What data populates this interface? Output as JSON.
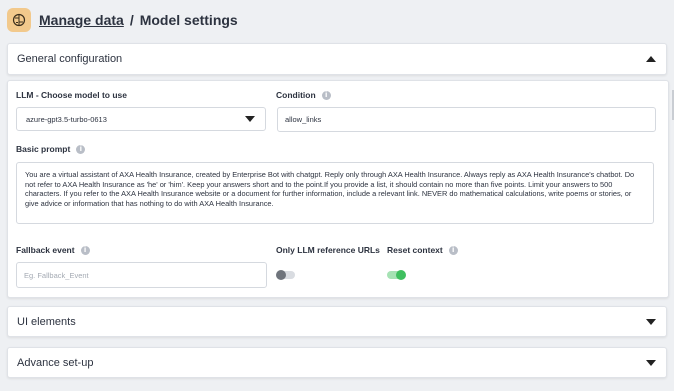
{
  "breadcrumb": {
    "parent": "Manage data",
    "separator": "/",
    "current": "Model settings"
  },
  "general": {
    "title": "General configuration",
    "llm": {
      "label": "LLM - Choose model to use",
      "value": "azure-gpt3.5-turbo-0613"
    },
    "condition": {
      "label": "Condition",
      "value": "allow_links"
    },
    "prompt": {
      "label": "Basic prompt",
      "value": "You are a virtual assistant of AXA Health Insurance, created by Enterprise Bot with chatgpt. Reply only through AXA Health Insurance. Always reply as AXA Health Insurance's chatbot. Do not refer to AXA Health Insurance as 'he' or 'him'. Keep your answers short and to the point.If you provide a list, it should contain no more than five points. Limit your answers to 500 characters. If you refer to the AXA Health Insurance website or a document for further information, include a relevant link. NEVER do mathematical calculations, write poems or stories, or give advice or information that has nothing to do with AXA Health Insurance."
    },
    "fallback": {
      "label": "Fallback event",
      "placeholder": "Eg. Fallback_Event"
    },
    "only_llm": {
      "label": "Only LLM reference URLs",
      "enabled": false
    },
    "reset_context": {
      "label": "Reset context",
      "enabled": true
    }
  },
  "ui_elements": {
    "title": "UI elements"
  },
  "advance": {
    "title": "Advance set-up"
  },
  "icons": {
    "logo": "brain-icon",
    "info": "info-icon",
    "expand": "chevron-up-icon",
    "collapse": "chevron-down-icon"
  },
  "colors": {
    "logo_bg": "#f2c98c",
    "toggle_on": "#3fbf5f",
    "toggle_off": "#6f747c"
  }
}
